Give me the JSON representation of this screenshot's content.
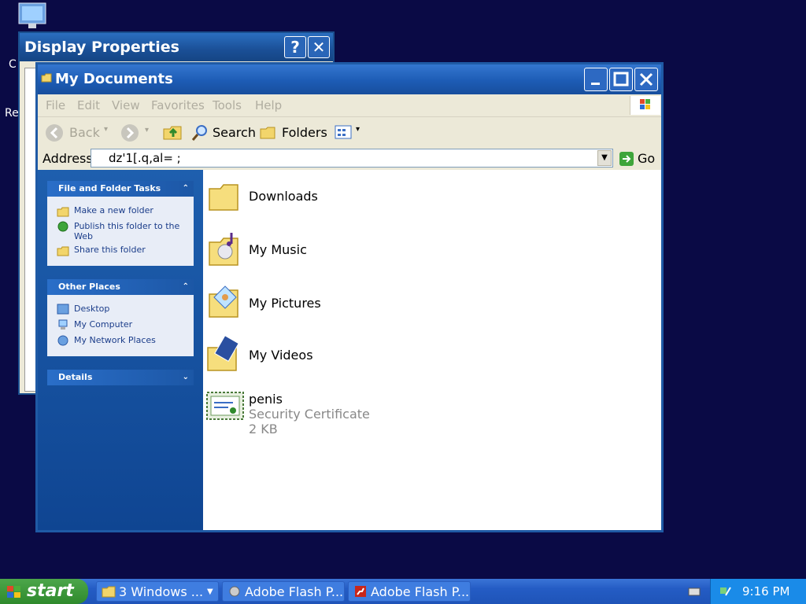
{
  "desktop": {
    "fragment_1": "C",
    "fragment_2": "Re"
  },
  "display_window": {
    "title": "Display Properties",
    "help_label": "?",
    "close_label": "✕"
  },
  "explorer": {
    "title": "My Documents",
    "menu": [
      "File",
      "Edit",
      "View",
      "Favorites",
      "Tools",
      "Help"
    ],
    "toolbar": {
      "back": "Back",
      "search": "Search",
      "folders": "Folders"
    },
    "address": {
      "label": "Address",
      "value": "dz'1[.q,al= ;",
      "go": "Go"
    },
    "sidebar": {
      "file_tasks": {
        "title": "File and Folder Tasks",
        "items": [
          "Make a new folder",
          "Publish this folder to the Web",
          "Share this folder"
        ]
      },
      "other_places": {
        "title": "Other Places",
        "items": [
          "Desktop",
          "My Computer",
          "My Network Places"
        ]
      },
      "details": {
        "title": "Details"
      }
    },
    "files": [
      {
        "name": "Downloads",
        "icon": "folder-icon"
      },
      {
        "name": "My Music",
        "icon": "music-folder-icon"
      },
      {
        "name": "My Pictures",
        "icon": "pictures-folder-icon"
      },
      {
        "name": "My Videos",
        "icon": "videos-folder-icon"
      },
      {
        "name": "penis",
        "type": "Security Certificate",
        "size": "2 KB",
        "icon": "certificate-icon"
      }
    ]
  },
  "taskbar": {
    "start": "start",
    "buttons": [
      "3 Windows ...",
      "Adobe Flash P...",
      "Adobe Flash P..."
    ],
    "clock": "9:16 PM"
  },
  "colors": {
    "desktop_bg": "#0a0a45",
    "title_blue": "#1d5cb5",
    "start_green": "#2f8a2c"
  }
}
